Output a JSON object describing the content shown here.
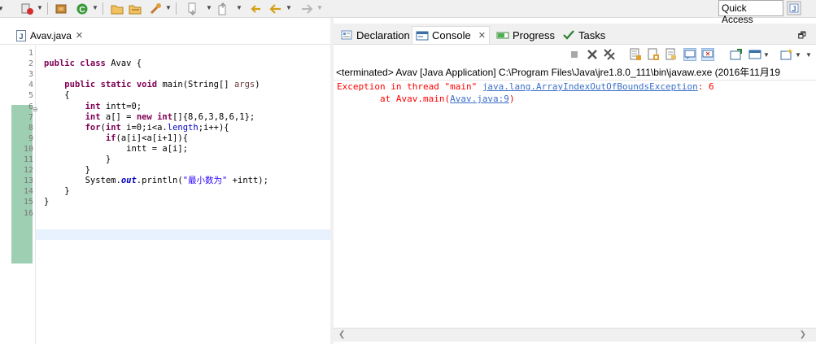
{
  "toolbar": {
    "quick_access": "Quick Access"
  },
  "editor": {
    "tab_label": "Avav.java",
    "line_numbers": [
      "1",
      "2",
      "3",
      "4",
      "5",
      "6",
      "7",
      "8",
      "9",
      "10",
      "11",
      "12",
      "13",
      "14",
      "15",
      "16"
    ],
    "code_lines": [
      "",
      "public class Avav {",
      "",
      "    public static void main(String[] args)",
      "    {",
      "        int intt=0;",
      "        int a[] = new int[]{8,6,3,8,6,1};",
      "        for(int i=0;i<a.length;i++){",
      "            if(a[i]<a[i+1]){",
      "                intt = a[i];",
      "            }",
      "        }",
      "        System.out.println(\"最小数为\" +intt);",
      "    }",
      "}",
      ""
    ]
  },
  "views": {
    "tabs": [
      {
        "label": "Declaration",
        "icon": "declaration-icon"
      },
      {
        "label": "Console",
        "icon": "console-icon",
        "active": true
      },
      {
        "label": "Progress",
        "icon": "progress-icon"
      },
      {
        "label": "Tasks",
        "icon": "tasks-icon"
      }
    ]
  },
  "console": {
    "status": "<terminated> Avav [Java Application] C:\\Program Files\\Java\\jre1.8.0_111\\bin\\javaw.exe (2016年11月19",
    "output": {
      "line1_prefix": "Exception in thread \"main\" ",
      "line1_link": "java.lang.ArrayIndexOutOfBoundsException",
      "line1_suffix": ": 6",
      "line2_prefix": "        at Avav.main(",
      "line2_link": "Avav.java:9",
      "line2_suffix": ")"
    }
  },
  "colors": {
    "keyword": "#7f0055",
    "string": "#2a00ff",
    "error": "#ff0000",
    "link": "#3a6fc8",
    "change_bar": "#9fcfb3"
  }
}
